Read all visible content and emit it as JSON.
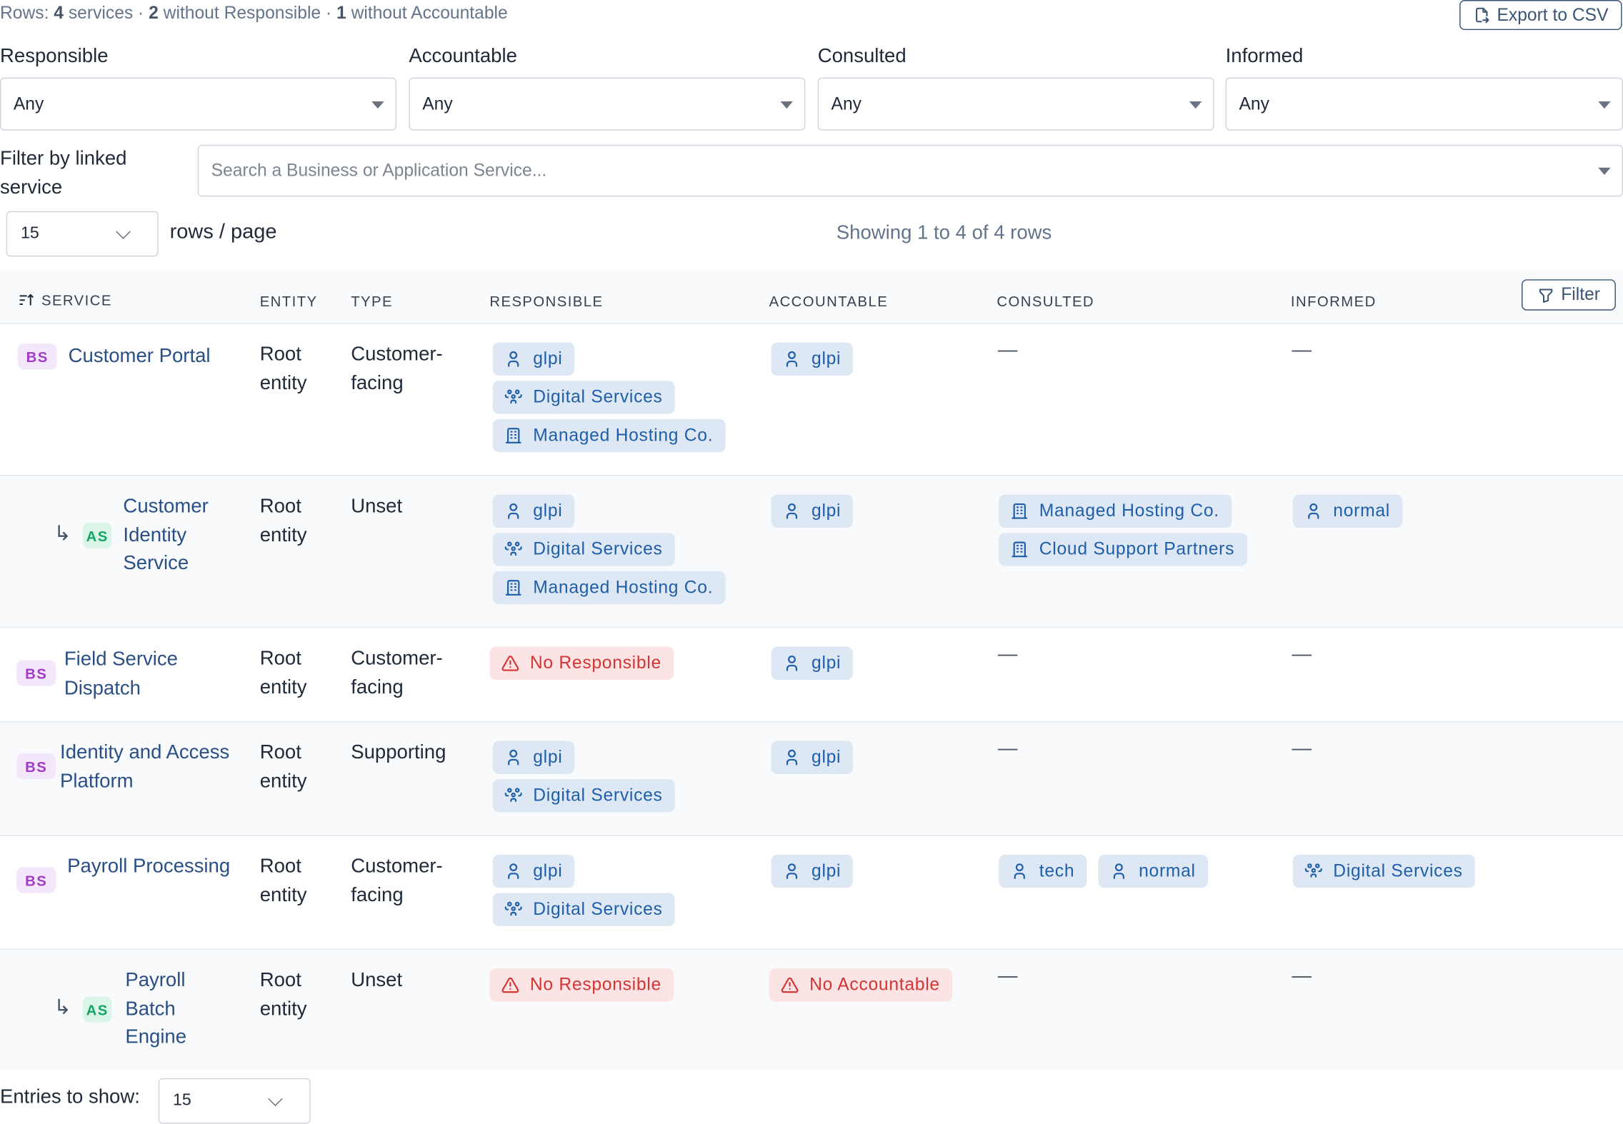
{
  "summary": {
    "prefix": "Rows: ",
    "services_count": "4",
    "services_label": " services · ",
    "no_responsible_count": "2",
    "no_responsible_label": " without Responsible · ",
    "no_accountable_count": "1",
    "no_accountable_label": " without Accountable"
  },
  "export_label": "Export to CSV",
  "filters": {
    "responsible": {
      "label": "Responsible",
      "value": "Any"
    },
    "accountable": {
      "label": "Accountable",
      "value": "Any"
    },
    "consulted": {
      "label": "Consulted",
      "value": "Any"
    },
    "informed": {
      "label": "Informed",
      "value": "Any"
    }
  },
  "linked_service": {
    "label": "Filter by linked service",
    "placeholder": "Search a Business or Application Service..."
  },
  "pagination": {
    "per_page": "15",
    "per_page_label": "rows / page",
    "showing": "Showing 1 to 4 of 4 rows",
    "entries_label": "Entries to show:",
    "entries_value": "15"
  },
  "table": {
    "headers": {
      "service": "SERVICE",
      "entity": "ENTITY",
      "type": "TYPE",
      "responsible": "RESPONSIBLE",
      "accountable": "ACCOUNTABLE",
      "consulted": "CONSULTED",
      "informed": "INFORMED"
    },
    "filter_label": "Filter",
    "empty_marker": "—",
    "rows": [
      {
        "badge": "BS",
        "name": "Customer Portal",
        "entity": "Root entity",
        "type": "Customer-facing",
        "responsible": [
          {
            "icon": "user-icon",
            "label": "glpi"
          },
          {
            "icon": "group-icon",
            "label": "Digital Services"
          },
          {
            "icon": "building-icon",
            "label": "Managed Hosting Co."
          }
        ],
        "accountable": [
          {
            "icon": "user-icon",
            "label": "glpi"
          }
        ],
        "consulted": [],
        "informed": []
      },
      {
        "badge": "AS",
        "name": "Customer Identity Service",
        "entity": "Root entity",
        "type": "Unset",
        "responsible": [
          {
            "icon": "user-icon",
            "label": "glpi"
          },
          {
            "icon": "group-icon",
            "label": "Digital Services"
          },
          {
            "icon": "building-icon",
            "label": "Managed Hosting Co."
          }
        ],
        "accountable": [
          {
            "icon": "user-icon",
            "label": "glpi"
          }
        ],
        "consulted": [
          {
            "icon": "building-icon",
            "label": "Managed Hosting Co."
          },
          {
            "icon": "building-icon",
            "label": "Cloud Support Partners"
          }
        ],
        "informed": [
          {
            "icon": "user-icon",
            "label": "normal"
          }
        ]
      },
      {
        "badge": "BS",
        "name": "Field Service Dispatch",
        "entity": "Root entity",
        "type": "Customer-facing",
        "responsible": [
          {
            "icon": "warning-icon",
            "label": "No Responsible"
          }
        ],
        "accountable": [
          {
            "icon": "user-icon",
            "label": "glpi"
          }
        ],
        "consulted": [],
        "informed": []
      },
      {
        "badge": "BS",
        "name": "Identity and Access Platform",
        "entity": "Root entity",
        "type": "Supporting",
        "responsible": [
          {
            "icon": "user-icon",
            "label": "glpi"
          },
          {
            "icon": "group-icon",
            "label": "Digital Services"
          }
        ],
        "accountable": [
          {
            "icon": "user-icon",
            "label": "glpi"
          }
        ],
        "consulted": [],
        "informed": []
      },
      {
        "badge": "BS",
        "name": "Payroll Processing",
        "entity": "Root entity",
        "type": "Customer-facing",
        "responsible": [
          {
            "icon": "user-icon",
            "label": "glpi"
          },
          {
            "icon": "group-icon",
            "label": "Digital Services"
          }
        ],
        "accountable": [
          {
            "icon": "user-icon",
            "label": "glpi"
          }
        ],
        "consulted": [
          {
            "icon": "user-icon",
            "label": "tech"
          },
          {
            "icon": "user-icon",
            "label": "normal"
          }
        ],
        "informed": [
          {
            "icon": "group-icon",
            "label": "Digital Services"
          }
        ]
      },
      {
        "badge": "AS",
        "name": "Payroll Batch Engine",
        "entity": "Root entity",
        "type": "Unset",
        "responsible": [
          {
            "icon": "warning-icon",
            "label": "No Responsible"
          }
        ],
        "accountable": [
          {
            "icon": "warning-icon",
            "label": "No Accountable"
          }
        ],
        "consulted": [],
        "informed": []
      }
    ]
  },
  "colors": {
    "accent": "#3b5476",
    "chip_bg": "#dde8f4",
    "chip_text": "#1f5ea8",
    "warn_bg": "#fde4e4",
    "warn_text": "#d33434",
    "bs_badge": "#a23bc7",
    "as_badge": "#17a567"
  }
}
